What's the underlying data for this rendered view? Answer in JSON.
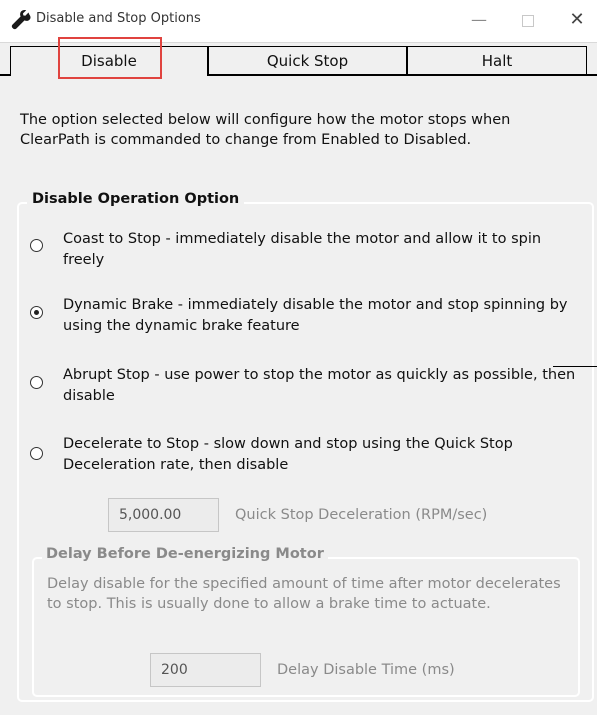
{
  "window": {
    "title": "Disable and Stop Options",
    "minimize_glyph": "—",
    "close_glyph": "✕",
    "icon": "wrench-icon"
  },
  "tabs": [
    {
      "label": "Disable",
      "selected": true
    },
    {
      "label": "Quick Stop",
      "selected": false
    },
    {
      "label": "Halt",
      "selected": false
    }
  ],
  "intro_text": "The option selected below will configure how the motor stops when ClearPath is commanded to change from Enabled to Disabled.",
  "disable_group": {
    "title": "Disable Operation Option",
    "options": [
      {
        "label": "Coast to Stop - immediately disable the motor and allow it to spin freely",
        "selected": false
      },
      {
        "label": "Dynamic Brake - immediately disable the motor and stop spinning by using the dynamic brake feature",
        "selected": true
      },
      {
        "label": "Abrupt Stop - use power to stop the motor as quickly as possible, then disable",
        "selected": false
      },
      {
        "label": "Decelerate to Stop - slow down and stop using the Quick Stop Deceleration rate, then disable",
        "selected": false
      }
    ],
    "decel_value": "5,000.00",
    "decel_label": "Quick Stop Deceleration (RPM/sec)"
  },
  "delay_group": {
    "title": "Delay Before De-energizing Motor",
    "description": "Delay disable for the specified amount of time after motor decelerates to stop. This is usually done to allow a brake time to actuate.",
    "delay_value": "200",
    "delay_label": "Delay Disable Time (ms)"
  },
  "colors": {
    "highlight": "#e0433f",
    "disabled_text": "#8a8a8a"
  }
}
